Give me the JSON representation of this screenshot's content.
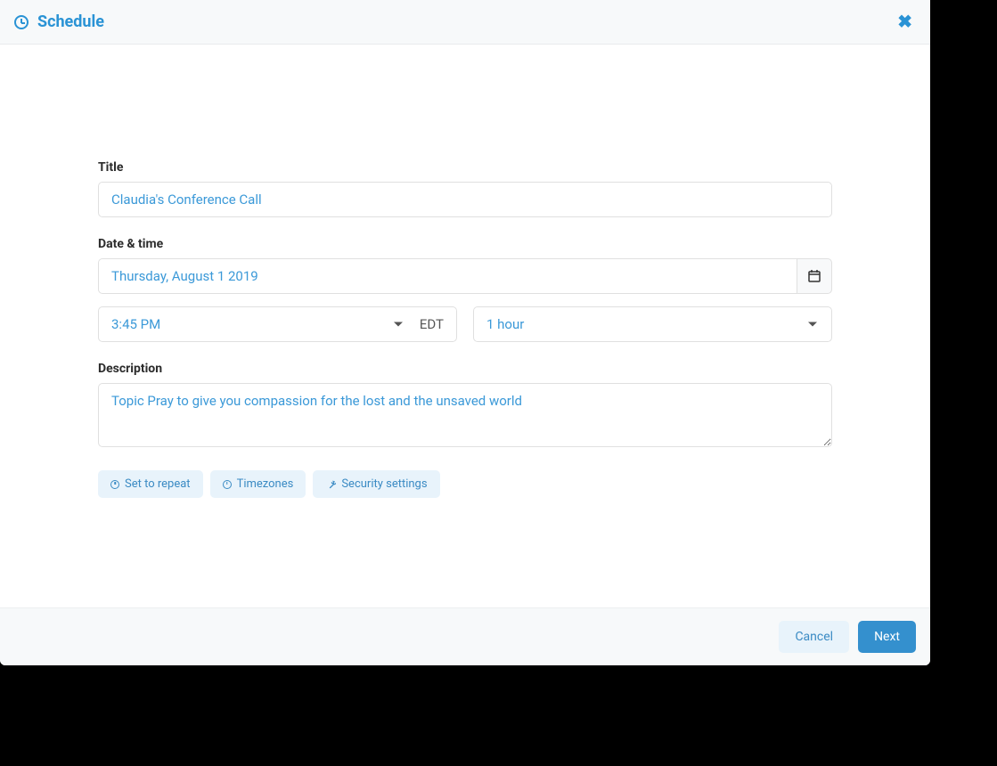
{
  "header": {
    "title": "Schedule"
  },
  "form": {
    "title_label": "Title",
    "title_value": "Claudia's Conference Call",
    "datetime_label": "Date & time",
    "date_value": "Thursday, August 1 2019",
    "time_value": "3:45 PM",
    "timezone": "EDT",
    "duration_value": "1 hour",
    "description_label": "Description",
    "description_value": "Topic Pray to give you compassion for the lost and the unsaved world"
  },
  "chips": {
    "repeat": "Set to repeat",
    "timezones": "Timezones",
    "security": "Security settings"
  },
  "footer": {
    "cancel": "Cancel",
    "next": "Next"
  }
}
